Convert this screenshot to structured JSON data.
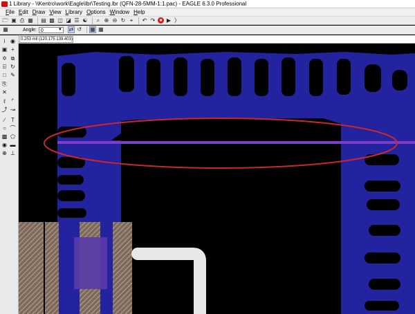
{
  "window": {
    "title": "1 Library - \\\\Kentro\\work\\Eagle\\lbr\\Testing.lbr (QFN-28-5MM-1:1.pac) - EAGLE 6.3.0 Professional"
  },
  "menu": {
    "items": [
      {
        "mnemonic": "F",
        "rest": "ile"
      },
      {
        "mnemonic": "E",
        "rest": "dit"
      },
      {
        "mnemonic": "D",
        "rest": "raw"
      },
      {
        "mnemonic": "V",
        "rest": "iew"
      },
      {
        "mnemonic": "L",
        "rest": "ibrary"
      },
      {
        "mnemonic": "O",
        "rest": "ptions"
      },
      {
        "mnemonic": "W",
        "rest": "indow"
      },
      {
        "mnemonic": "H",
        "rest": "elp"
      }
    ]
  },
  "toolbar2": {
    "angle_label": "Angle:",
    "angle_value": "0"
  },
  "status": {
    "coordinates": "0.253 mil (120.175 139.403)"
  },
  "colors": {
    "copper_blue": "#2323a0",
    "annotation_red": "#c8282e",
    "highlight_purple": "#7a3ec8",
    "tdocu_tan": "#9c8470",
    "silk_white": "#e8e8e8"
  }
}
